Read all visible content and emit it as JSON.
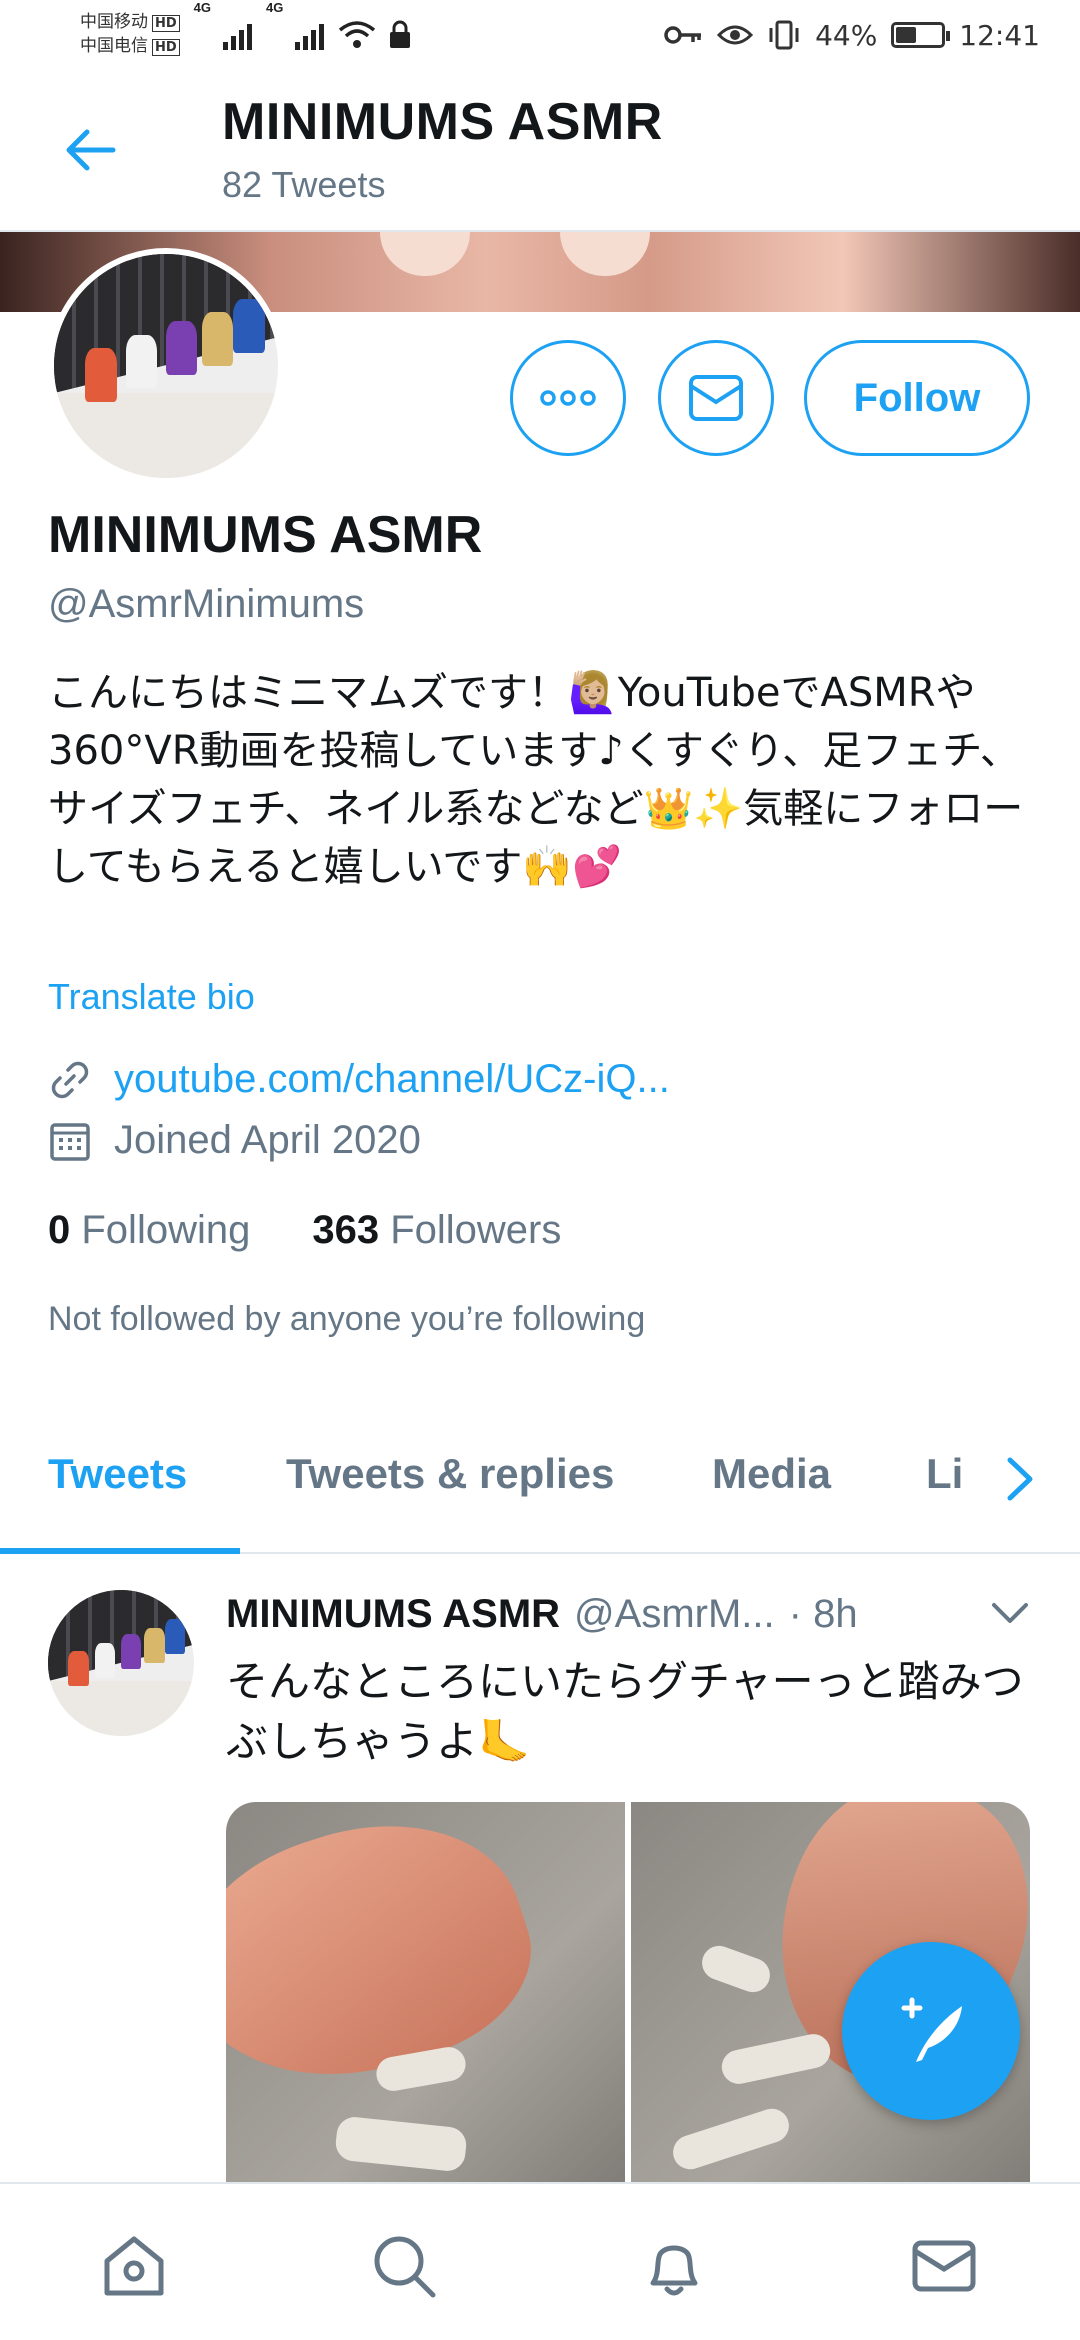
{
  "status_bar": {
    "carrier1": "中国移动",
    "carrier2": "中国电信",
    "hd": "HD",
    "network": "4G",
    "battery_percent": "44%",
    "battery_level": 0.44,
    "time": "12:41"
  },
  "header": {
    "title": "MINIMUMS ASMR",
    "tweet_count": "82 Tweets"
  },
  "profile": {
    "follow_label": "Follow",
    "name": "MINIMUMS ASMR",
    "handle": "@AsmrMinimums",
    "bio": "こんにちはミニマムズです！🙋🏼‍♀️YouTubeでASMRや360°VR動画を投稿しています♪くすぐり、足フェチ、サイズフェチ、ネイル系などなど👑✨気軽にフォローしてもらえると嬉しいです🙌💕",
    "translate_label": "Translate bio",
    "link": "youtube.com/channel/UCz-iQ...",
    "joined": "Joined April 2020",
    "following_count": "0",
    "following_label": "Following",
    "followers_count": "363",
    "followers_label": "Followers",
    "not_followed": "Not followed by anyone you’re following"
  },
  "tabs": [
    {
      "label": "Tweets"
    },
    {
      "label": "Tweets & replies"
    },
    {
      "label": "Media"
    },
    {
      "label": "Li"
    }
  ],
  "tweet": {
    "name": "MINIMUMS ASMR",
    "handle": "@AsmrM...",
    "time": "· 8h",
    "text": "そんなところにいたらグチャーっと踏みつぶしちゃうよ🦶"
  },
  "colors": {
    "accent": "#1da1f2",
    "secondary_text": "#657786"
  },
  "icons": {
    "back": "arrow-left-icon",
    "more": "more-icon",
    "dm": "mail-icon",
    "link": "link-icon",
    "calendar": "calendar-icon",
    "tab_next": "chevron-right-icon",
    "tweet_menu": "chevron-down-icon",
    "compose": "compose-icon",
    "home": "home-icon",
    "search": "search-icon",
    "notifications": "bell-icon",
    "messages": "mail-icon"
  }
}
